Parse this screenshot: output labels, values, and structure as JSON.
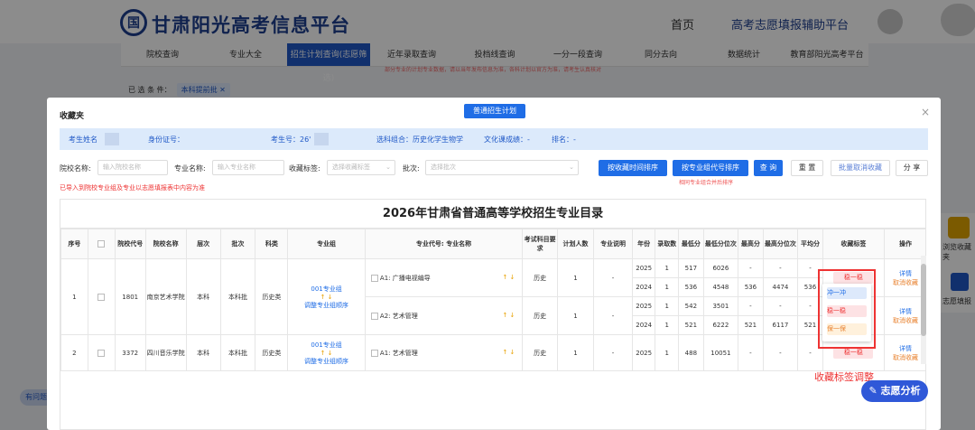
{
  "site": {
    "title": "甘肃阳光高考信息平台",
    "logo": "国",
    "nav": [
      "首页",
      "高考志愿填报辅助平台"
    ]
  },
  "subnav": [
    "院校查询",
    "专业大全",
    "招生计划查询(志愿筛选)",
    "近年录取查询",
    "投档线查询",
    "一分一段查询",
    "同分去向",
    "数据统计",
    "教育部阳光高考平台"
  ],
  "subnav_active_index": 2,
  "banner_text": "部分专业的计划专业数据，请以当年发布信息为准，各科计划以官方为准，请考生认真核对",
  "filter": {
    "label": "已 选 条 件：",
    "tag": "本科提前批"
  },
  "side": {
    "label1": "浏览收藏夹",
    "label2": "志愿填报"
  },
  "ask_label": "有问题",
  "modal": {
    "title": "收藏夹",
    "plan_button": "普通招生计划",
    "close": "×",
    "info": {
      "name_label": "考生姓名",
      "id_label": "身份证号：",
      "exam_no_label": "考生号：",
      "exam_no_value": "26'",
      "subject_label": "选科组合：历史化学生物学",
      "score_label": "文化课成绩：-",
      "rank_label": "排名：-"
    },
    "search": {
      "school_label": "院校名称:",
      "school_placeholder": "输入院校名称",
      "major_label": "专业名称:",
      "major_placeholder": "输入专业名称",
      "tag_label": "收藏标签:",
      "tag_placeholder": "选择收藏标签",
      "batch_label": "批次:",
      "batch_placeholder": "选择批次",
      "btn_sort_time": "按收藏时间排序",
      "btn_sort_code": "按专业组代号排序",
      "btn_query": "查 询",
      "btn_reset": "重 置",
      "btn_batch_cancel": "批量取消收藏",
      "btn_share": "分 享",
      "hint": "相同专业组合并后排序"
    },
    "warning": "已导入到院校专业组及专业以志愿填报表中内容为准"
  },
  "table": {
    "title": "2026年甘肃省普通高等学校招生专业目录",
    "headers": [
      "序号",
      "",
      "院校代号",
      "院校名称",
      "层次",
      "批次",
      "科类",
      "专业组",
      "专业代号: 专业名称",
      "考试科目要求",
      "计划人数",
      "专业说明",
      "年份",
      "录取数",
      "最低分",
      "最低分位次",
      "最高分",
      "最高分位次",
      "平均分",
      "收藏标签",
      "操作"
    ],
    "rows": [
      {
        "seq": "1",
        "code": "1801",
        "school": "南京艺术学院",
        "level": "本科",
        "batch": "本科批",
        "category": "历史类",
        "group": "001专业组",
        "group_link": "调整专业组顺序",
        "majors": [
          {
            "name": "A1: 广播电视编导",
            "req": "历史",
            "plan": "1",
            "note": "-",
            "years": [
              {
                "year": "2025",
                "adm": "1",
                "min": "517",
                "min_rank": "6026",
                "max": "-",
                "max_rank": "-",
                "avg": "-",
                "tag": "稳一稳"
              },
              {
                "year": "2024",
                "adm": "1",
                "min": "536",
                "min_rank": "4548",
                "max": "536",
                "max_rank": "4474",
                "avg": "536",
                "tag": ""
              }
            ]
          },
          {
            "name": "A2: 艺术管理",
            "req": "历史",
            "plan": "1",
            "note": "-",
            "years": [
              {
                "year": "2025",
                "adm": "1",
                "min": "542",
                "min_rank": "3501",
                "max": "-",
                "max_rank": "-",
                "avg": "-",
                "tag": ""
              },
              {
                "year": "2024",
                "adm": "1",
                "min": "521",
                "min_rank": "6222",
                "max": "521",
                "max_rank": "6117",
                "avg": "521",
                "tag": ""
              }
            ]
          }
        ]
      },
      {
        "seq": "2",
        "code": "3372",
        "school": "四川音乐学院",
        "level": "本科",
        "batch": "本科批",
        "category": "历史类",
        "group": "001专业组",
        "group_link": "调整专业组顺序",
        "majors": [
          {
            "name": "A1: 艺术管理",
            "req": "历史",
            "plan": "1",
            "note": "-",
            "years": [
              {
                "year": "2025",
                "adm": "1",
                "min": "488",
                "min_rank": "10051",
                "max": "-",
                "max_rank": "-",
                "avg": "-",
                "tag": "稳一稳"
              }
            ]
          }
        ]
      }
    ],
    "action_detail": "详情",
    "action_cancel": "取消收藏"
  },
  "tag_popup": {
    "chong": "冲一冲",
    "wen": "稳一稳",
    "bao": "保一保"
  },
  "annotation": "收藏标签调整",
  "analysis_button": "志愿分析",
  "colors": {
    "primary": "#1f6de6",
    "brand": "#1e3f8f",
    "red": "#e33",
    "orange": "#e8812e"
  }
}
